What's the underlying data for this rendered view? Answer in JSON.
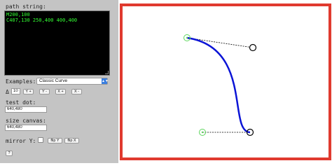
{
  "panel": {
    "path_label": "path string:",
    "path_lines": [
      "M200,100",
      "C407,130 250,400 400,400"
    ],
    "examples_label": "Examples:",
    "examples_selected": "Classic Curve",
    "delta_label": "Δ",
    "delta_value": "10",
    "buttons": {
      "y_plus": "Y +",
      "y_minus": "Y -",
      "x_plus": "X +",
      "x_minus": "X -"
    },
    "test_dot_label": "test dot:",
    "test_dot_value": "640,480",
    "size_canvas_label": "size canvas:",
    "size_canvas_value": "640,480",
    "mirror_label": "mirror Y:",
    "flip_y": "flip Y",
    "flip_x": "flip X",
    "help": "?"
  },
  "colors": {
    "curve": "#0b14d6",
    "frame": "#e03a2f",
    "start_point": "#5dd55d",
    "control_point": "#000000",
    "path_text": "#33ff33"
  }
}
